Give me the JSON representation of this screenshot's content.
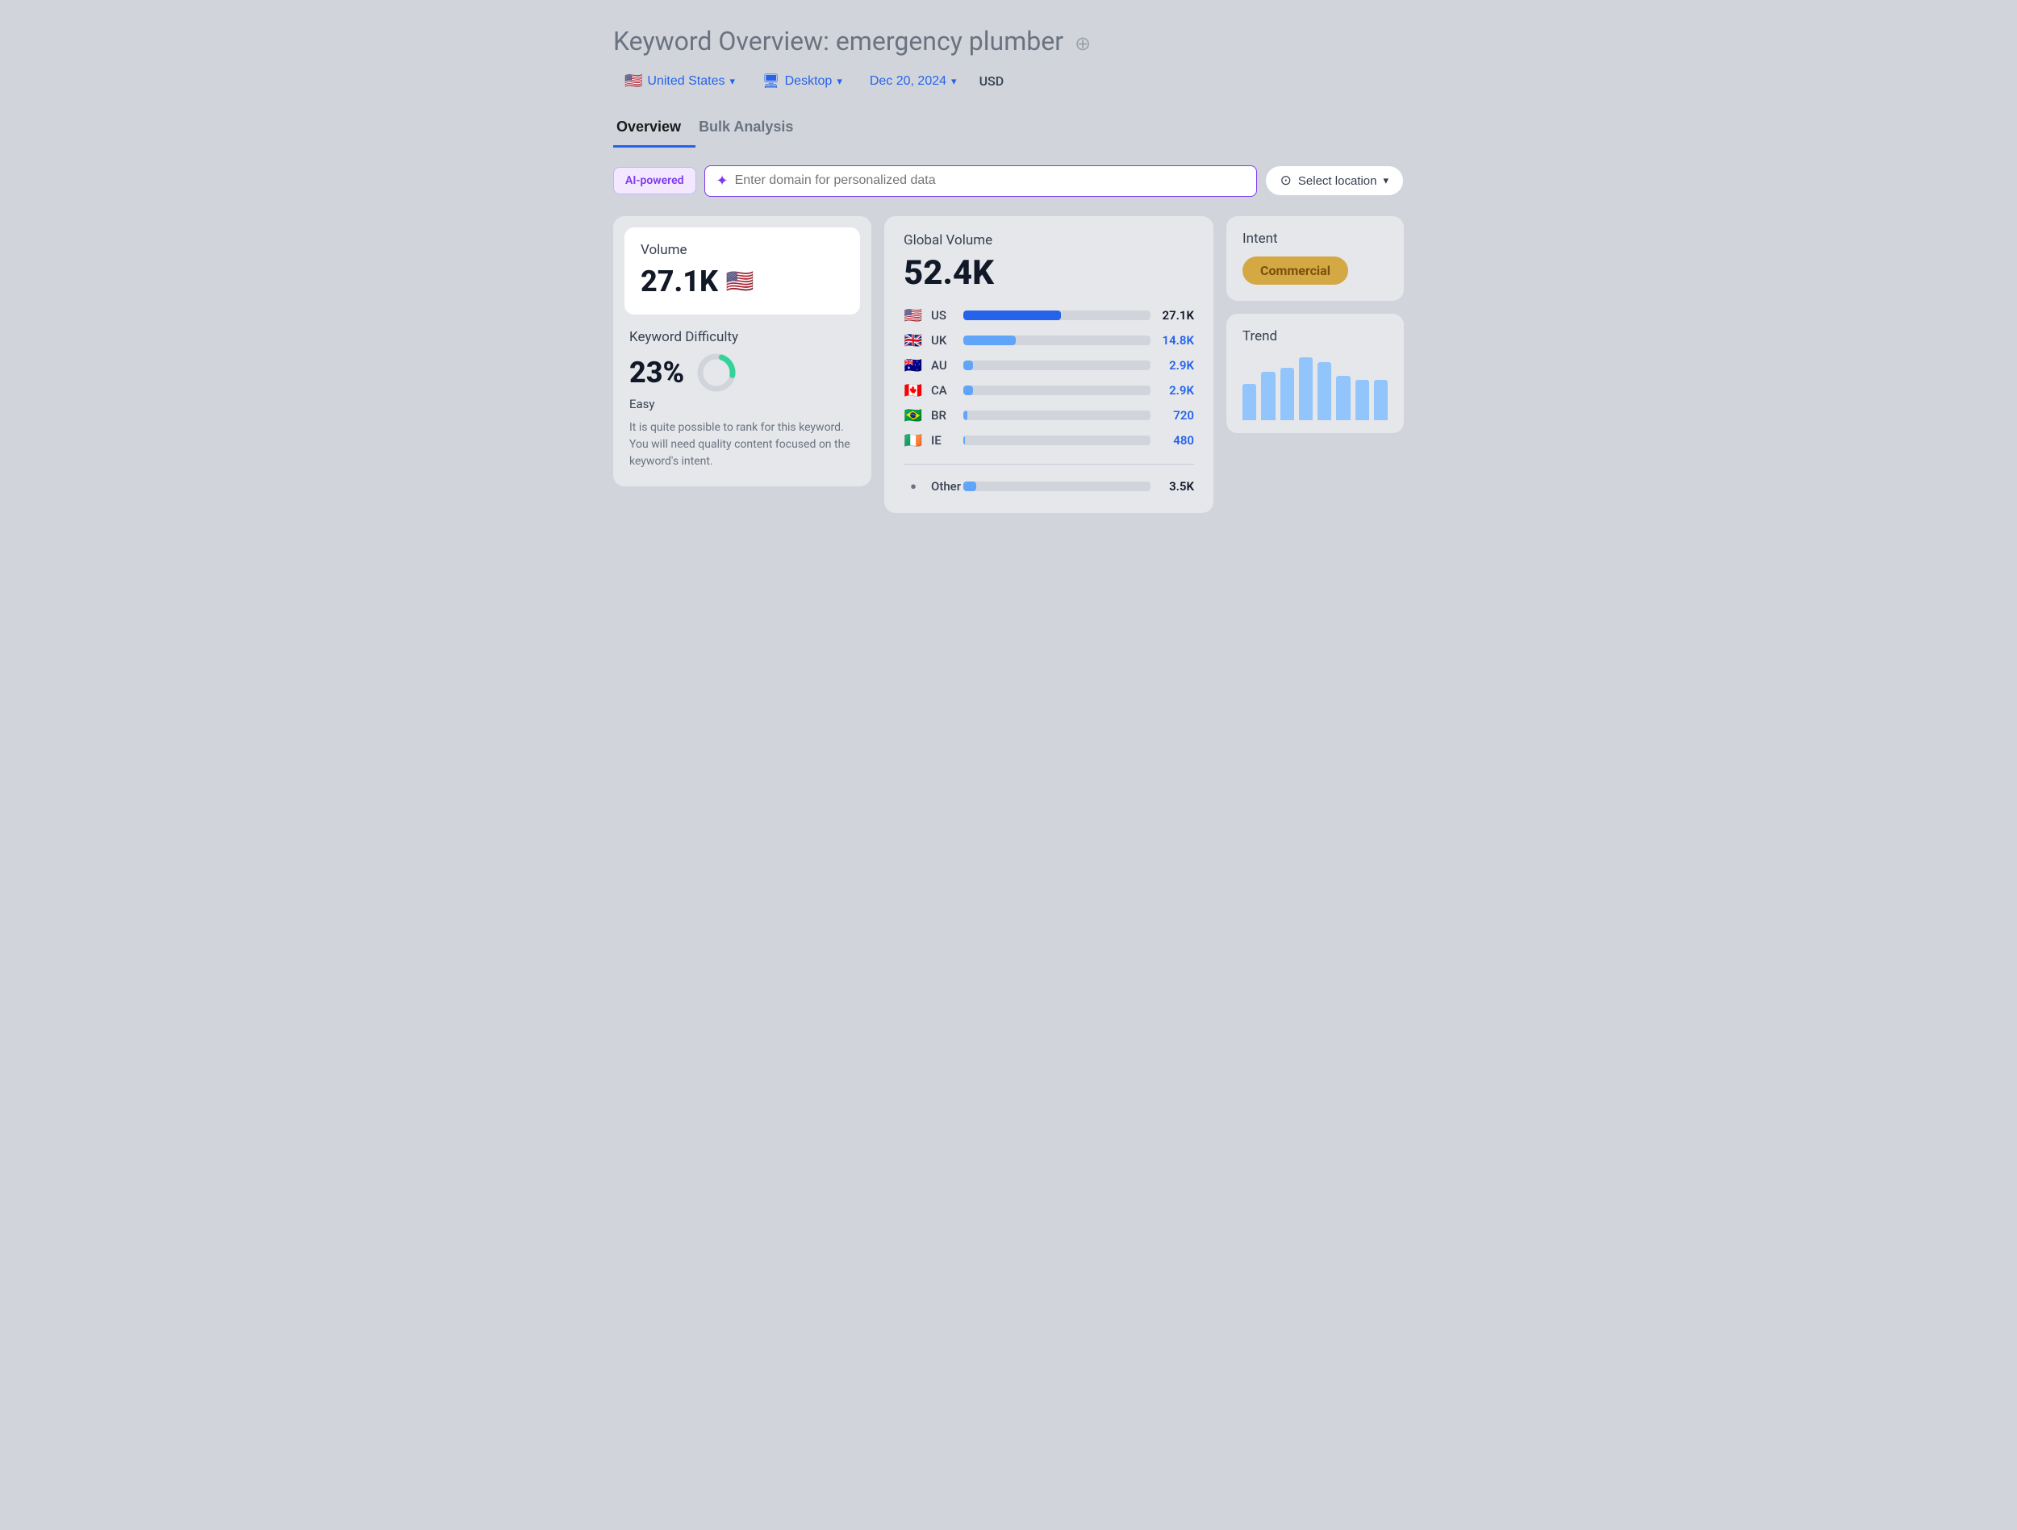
{
  "header": {
    "title_prefix": "Keyword Overview:",
    "title_keyword": "emergency plumber",
    "add_icon": "⊕",
    "location": "United States",
    "location_flag": "🇺🇸",
    "device": "Desktop",
    "date": "Dec 20, 2024",
    "currency": "USD"
  },
  "tabs": [
    {
      "label": "Overview",
      "active": true
    },
    {
      "label": "Bulk Analysis",
      "active": false
    }
  ],
  "ai_row": {
    "badge": "AI-powered",
    "input_placeholder": "Enter domain for personalized data",
    "location_btn": "Select location",
    "sparkle_icon": "✦"
  },
  "volume_card": {
    "volume_label": "Volume",
    "volume_value": "27.1K",
    "volume_flag": "🇺🇸",
    "kd_label": "Keyword Difficulty",
    "kd_percent": "23%",
    "kd_ease": "Easy",
    "kd_desc": "It is quite possible to rank for this keyword. You will need quality content focused on the keyword's intent.",
    "kd_value": 23
  },
  "global_card": {
    "label": "Global Volume",
    "value": "52.4K",
    "countries": [
      {
        "flag": "🇺🇸",
        "code": "US",
        "bar_pct": 52,
        "value": "27.1K",
        "dark": true
      },
      {
        "flag": "🇬🇧",
        "code": "UK",
        "bar_pct": 28,
        "value": "14.8K",
        "dark": false
      },
      {
        "flag": "🇦🇺",
        "code": "AU",
        "bar_pct": 5,
        "value": "2.9K",
        "dark": false
      },
      {
        "flag": "🇨🇦",
        "code": "CA",
        "bar_pct": 5,
        "value": "2.9K",
        "dark": false
      },
      {
        "flag": "🇧🇷",
        "code": "BR",
        "bar_pct": 2,
        "value": "720",
        "dark": false
      },
      {
        "flag": "🇮🇪",
        "code": "IE",
        "bar_pct": 1,
        "value": "480",
        "dark": false
      }
    ],
    "other_label": "Other",
    "other_bar_pct": 7,
    "other_value": "3.5K"
  },
  "intent_card": {
    "label": "Intent",
    "badge": "Commercial"
  },
  "trend_card": {
    "label": "Trend",
    "bars": [
      45,
      60,
      65,
      80,
      75,
      55,
      50,
      50
    ]
  }
}
